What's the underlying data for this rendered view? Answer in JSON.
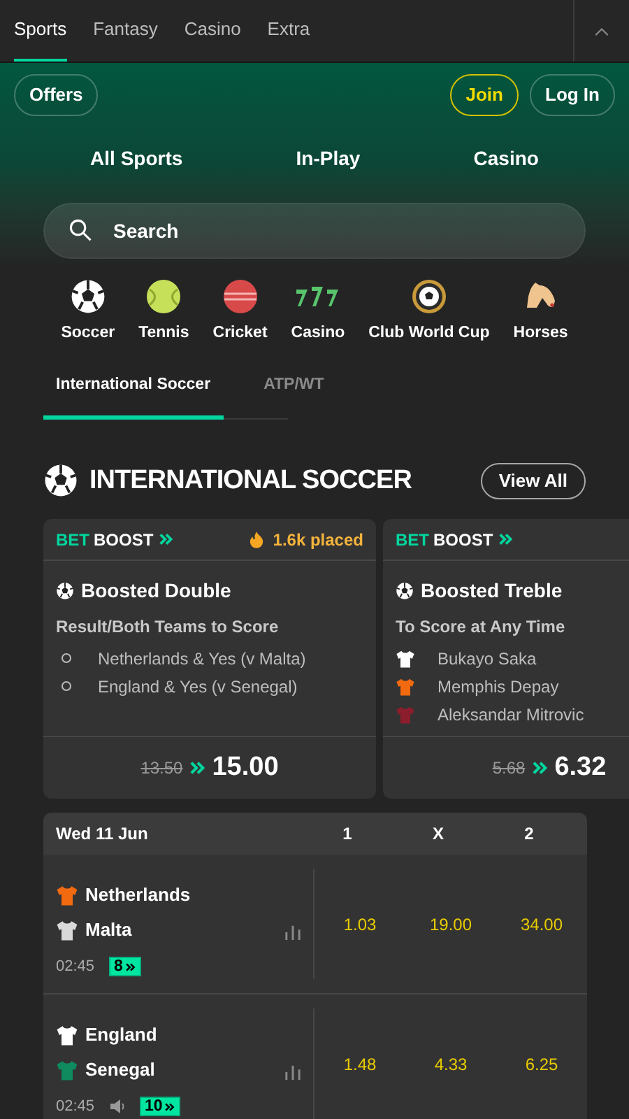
{
  "top_tabs": [
    {
      "label": "Sports",
      "selected": true
    },
    {
      "label": "Fantasy",
      "selected": false
    },
    {
      "label": "Casino",
      "selected": false
    },
    {
      "label": "Extra",
      "selected": false
    }
  ],
  "header": {
    "offers": "Offers",
    "join": "Join",
    "login": "Log In"
  },
  "nav_links": [
    "All Sports",
    "In-Play",
    "Casino"
  ],
  "search": {
    "placeholder": "Search"
  },
  "sports": [
    {
      "label": "Soccer",
      "kind": "soccer"
    },
    {
      "label": "Tennis",
      "kind": "tennis"
    },
    {
      "label": "Cricket",
      "kind": "cricket"
    },
    {
      "label": "Casino",
      "kind": "slots"
    },
    {
      "label": "Club World Cup",
      "kind": "medal"
    },
    {
      "label": "Horses",
      "kind": "horse"
    }
  ],
  "sub_tabs": [
    {
      "label": "International Soccer",
      "selected": true
    },
    {
      "label": "ATP/WT",
      "selected": false
    }
  ],
  "section": {
    "title": "INTERNATIONAL SOCCER",
    "view_all": "View All"
  },
  "boosts": [
    {
      "badge_bet": "BET",
      "badge_boost": "BOOST",
      "placed": "1.6k placed",
      "title": "Boosted Double",
      "market": "Result/Both Teams to Score",
      "selections": [
        {
          "name": "Netherlands & Yes (v Malta)",
          "kind": "bullet"
        },
        {
          "name": "England & Yes (v Senegal)",
          "kind": "bullet"
        }
      ],
      "old_price": "13.50",
      "new_price": "15.00"
    },
    {
      "badge_bet": "BET",
      "badge_boost": "BOOST",
      "title": "Boosted Treble",
      "market": "To Score at Any Time",
      "selections": [
        {
          "name": "Bukayo Saka",
          "kind": "shirt",
          "color": "#ffffff"
        },
        {
          "name": "Memphis Depay",
          "kind": "shirt",
          "color": "#f26a10"
        },
        {
          "name": "Aleksandar Mitrovic",
          "kind": "shirt",
          "color": "#8c1d2c"
        }
      ],
      "old_price": "5.68",
      "new_price": "6.32"
    }
  ],
  "matches": {
    "date": "Wed 11 Jun",
    "columns": [
      "1",
      "X",
      "2"
    ],
    "rows": [
      {
        "teams": [
          {
            "name": "Netherlands",
            "color": "#f26a10"
          },
          {
            "name": "Malta",
            "color": "#d9d9d9"
          }
        ],
        "time": "02:45",
        "audio": false,
        "boosts": "8",
        "odds": [
          "1.03",
          "19.00",
          "34.00"
        ]
      },
      {
        "teams": [
          {
            "name": "England",
            "color": "#ffffff"
          },
          {
            "name": "Senegal",
            "color": "#0f8a5f"
          }
        ],
        "time": "02:45",
        "audio": true,
        "boosts": "10",
        "odds": [
          "1.48",
          "4.33",
          "6.25"
        ]
      }
    ]
  }
}
